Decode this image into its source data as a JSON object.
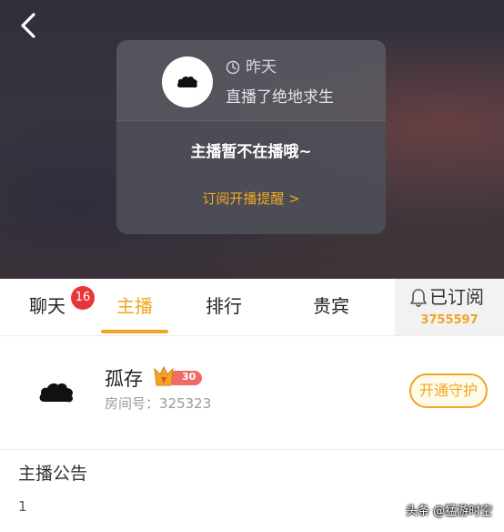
{
  "card": {
    "time": "昨天",
    "activity": "直播了绝地求生",
    "status": "主播暂不在播哦~",
    "subscribe_link": "订阅开播提醒 >"
  },
  "tabs": [
    {
      "label": "聊天",
      "badge": "16"
    },
    {
      "label": "主播"
    },
    {
      "label": "排行"
    },
    {
      "label": "贵宾"
    }
  ],
  "subscribe": {
    "label": "已订阅",
    "count": "3755597"
  },
  "anchor": {
    "name": "孤存",
    "level": "30",
    "room": "房间号：325323",
    "guard_button": "开通守护"
  },
  "notice": {
    "title": "主播公告",
    "body": "1"
  },
  "watermark": "头条 @猛游时空",
  "colors": {
    "accent": "#f0a623",
    "badge": "#e8353a"
  }
}
